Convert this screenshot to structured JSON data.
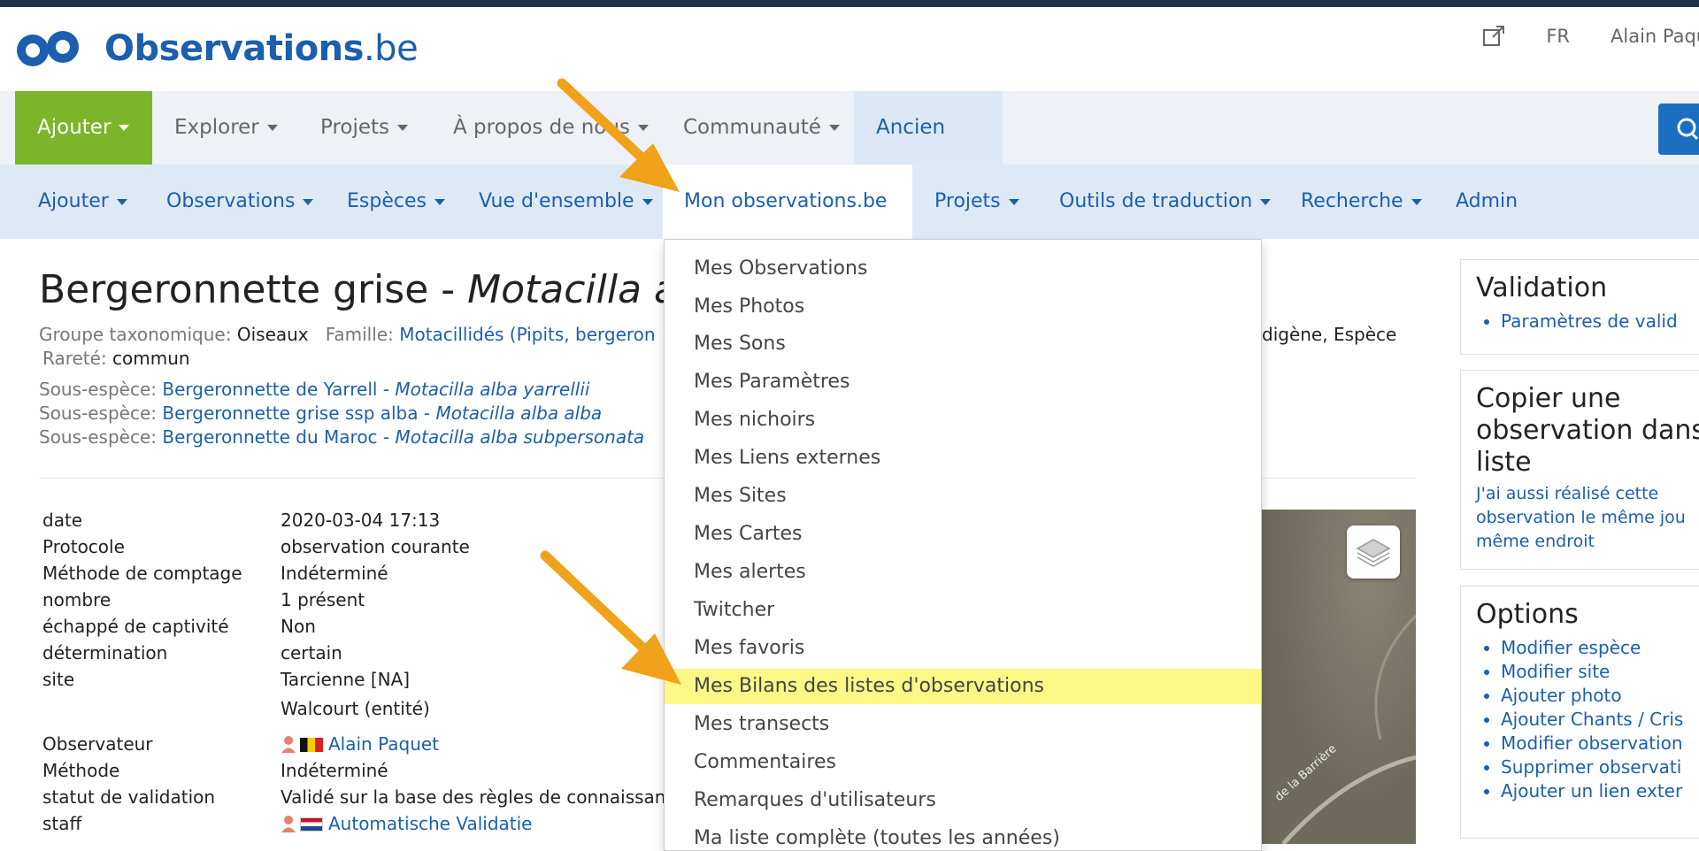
{
  "brand": {
    "name": "Observations",
    "tld": ".be"
  },
  "header": {
    "lang": "FR",
    "user": "Alain Paquet"
  },
  "nav1": {
    "items": [
      "Ajouter",
      "Explorer",
      "Projets",
      "À propos de nous",
      "Communauté",
      "Ancien site"
    ]
  },
  "nav2": {
    "items": [
      "Ajouter",
      "Observations",
      "Espèces",
      "Vue d'ensemble",
      "Mon observations.be",
      "Projets",
      "Outils de traduction",
      "Recherche",
      "Admin"
    ]
  },
  "species": {
    "title_common": "Bergeronnette grise - ",
    "title_latin": "Motacilla alb",
    "groupe_label": "Groupe taxonomique:",
    "groupe_value": "Oiseaux",
    "famille_label": "Famille:",
    "famille_value": "Motacillidés (Pipits, bergeron",
    "status_tail": "digène, Espèce",
    "rarete_label": "Rareté:",
    "rarete_value": "commun",
    "subspecies": [
      {
        "label": "Sous-espèce:",
        "name": "Bergeronnette de Yarrell - ",
        "latin": "Motacilla alba yarrellii"
      },
      {
        "label": "Sous-espèce:",
        "name": "Bergeronnette grise ssp alba - ",
        "latin": "Motacilla alba alba"
      },
      {
        "label": "Sous-espèce:",
        "name": "Bergeronnette du Maroc - ",
        "latin": "Motacilla alba subpersonata"
      }
    ]
  },
  "details": [
    {
      "label": "date",
      "value": "2020-03-04 17:13"
    },
    {
      "label": "Protocole",
      "value": "observation courante"
    },
    {
      "label": "Méthode de comptage",
      "value": "Indéterminé"
    },
    {
      "label": "nombre",
      "value": "1 présent"
    },
    {
      "label": "échappé de captivité",
      "value": "Non"
    },
    {
      "label": "détermination",
      "value": "certain"
    },
    {
      "label": "site",
      "value": "Tarcienne [NA]"
    },
    {
      "label": "",
      "value": "Walcourt (entité)"
    },
    {
      "label": "Observateur",
      "value": "Alain Paquet"
    },
    {
      "label": "Méthode",
      "value": "Indéterminé"
    },
    {
      "label": "statut de validation",
      "value": "Validé sur la base des règles de connaissan"
    },
    {
      "label": "staff",
      "value": "Automatische Validatie"
    }
  ],
  "map": {
    "road_label": "de la Barrière"
  },
  "dropdown": {
    "items": [
      "Mes Observations",
      "Mes Photos",
      "Mes Sons",
      "Mes Paramètres",
      "Mes nichoirs",
      "Mes Liens externes",
      "Mes Sites",
      "Mes Cartes",
      "Mes alertes",
      "Twitcher",
      "Mes favoris",
      "Mes Bilans des listes d'observations",
      "Mes transects",
      "Commentaires",
      "Remarques d'utilisateurs",
      "Ma liste complète (toutes les années)"
    ],
    "highlighted_index": 11
  },
  "sidebar": {
    "validation": {
      "title": "Validation",
      "items": [
        "Paramètres de valid"
      ]
    },
    "copy": {
      "title_lines": [
        "Copier une",
        "observation dans",
        "liste"
      ],
      "text_lines": [
        "J'ai aussi réalisé cette",
        "observation le même jou",
        "même endroit"
      ]
    },
    "options": {
      "title": "Options",
      "items": [
        "Modifier espèce",
        "Modifier site",
        "Ajouter photo",
        "Ajouter Chants / Cris",
        "Modifier observation",
        "Supprimer observati",
        "Ajouter un lien exter"
      ]
    }
  },
  "colors": {
    "brand": "#1b5fae",
    "green": "#7cb52a",
    "highlight": "#fdf886",
    "arrow": "#f0a21a"
  }
}
